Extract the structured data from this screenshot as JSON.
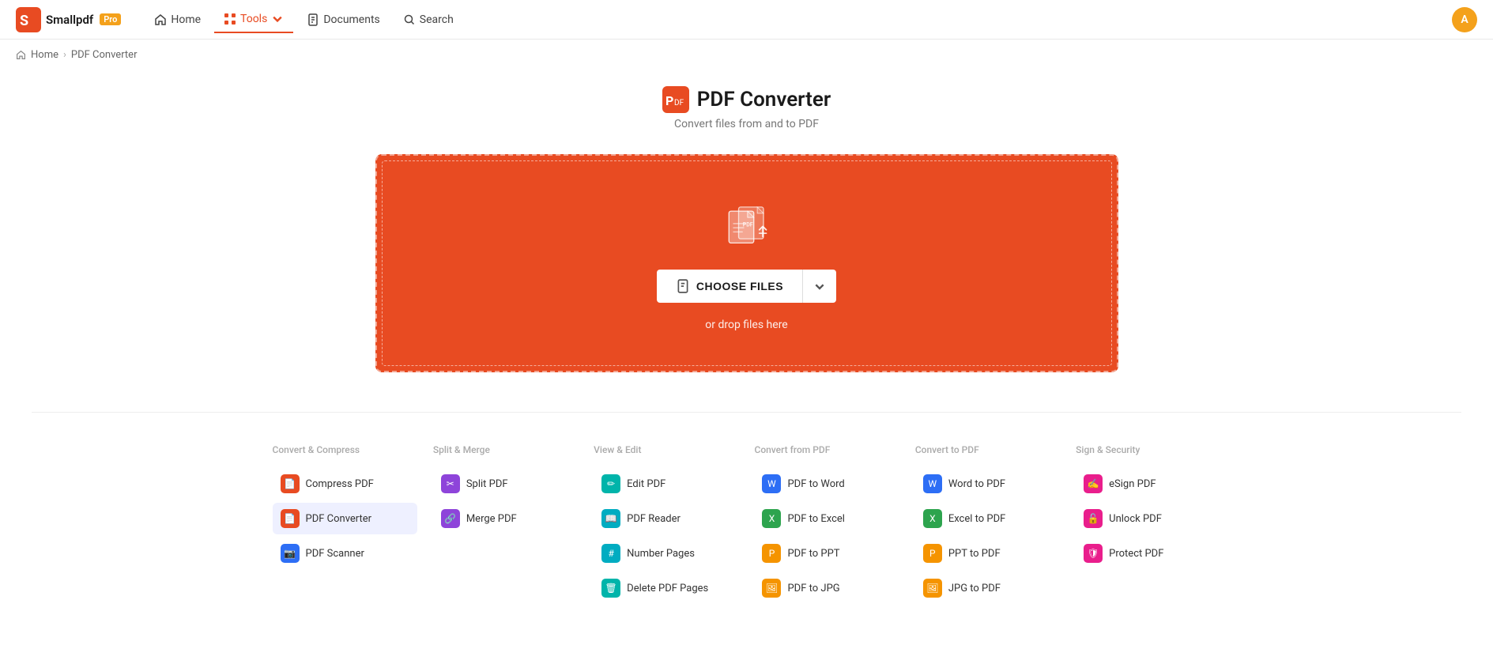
{
  "brand": {
    "name": "Smallpdf",
    "pro_label": "Pro",
    "logo_color": "#e84b22"
  },
  "nav": {
    "home_label": "Home",
    "tools_label": "Tools",
    "documents_label": "Documents",
    "search_label": "Search",
    "avatar_initials": "A"
  },
  "breadcrumb": {
    "home": "Home",
    "current": "PDF Converter"
  },
  "page": {
    "title": "PDF Converter",
    "subtitle": "Convert files from and to PDF"
  },
  "dropzone": {
    "choose_files_label": "CHOOSE FILES",
    "drop_hint": "or drop files here"
  },
  "tools": {
    "columns": [
      {
        "title": "Convert & Compress",
        "items": [
          {
            "label": "Compress PDF",
            "icon_color": "ic-red",
            "icon_char": "📄",
            "active": false
          },
          {
            "label": "PDF Converter",
            "icon_color": "ic-orange-red",
            "icon_char": "📄",
            "active": true
          },
          {
            "label": "PDF Scanner",
            "icon_color": "ic-blue",
            "icon_char": "📷",
            "active": false
          }
        ]
      },
      {
        "title": "Split & Merge",
        "items": [
          {
            "label": "Split PDF",
            "icon_color": "ic-purple",
            "icon_char": "✂",
            "active": false
          },
          {
            "label": "Merge PDF",
            "icon_color": "ic-purple",
            "icon_char": "🔗",
            "active": false
          }
        ]
      },
      {
        "title": "View & Edit",
        "items": [
          {
            "label": "Edit PDF",
            "icon_color": "ic-teal",
            "icon_char": "✏",
            "active": false
          },
          {
            "label": "PDF Reader",
            "icon_color": "ic-cyan",
            "icon_char": "📖",
            "active": false
          },
          {
            "label": "Number Pages",
            "icon_color": "ic-cyan",
            "icon_char": "#",
            "active": false
          },
          {
            "label": "Delete PDF Pages",
            "icon_color": "ic-teal",
            "icon_char": "🗑",
            "active": false
          }
        ]
      },
      {
        "title": "Convert from PDF",
        "items": [
          {
            "label": "PDF to Word",
            "icon_color": "ic-blue",
            "icon_char": "W",
            "active": false
          },
          {
            "label": "PDF to Excel",
            "icon_color": "ic-green",
            "icon_char": "X",
            "active": false
          },
          {
            "label": "PDF to PPT",
            "icon_color": "ic-orange",
            "icon_char": "P",
            "active": false
          },
          {
            "label": "PDF to JPG",
            "icon_color": "ic-orange",
            "icon_char": "🖼",
            "active": false
          }
        ]
      },
      {
        "title": "Convert to PDF",
        "items": [
          {
            "label": "Word to PDF",
            "icon_color": "ic-blue",
            "icon_char": "W",
            "active": false
          },
          {
            "label": "Excel to PDF",
            "icon_color": "ic-green",
            "icon_char": "X",
            "active": false
          },
          {
            "label": "PPT to PDF",
            "icon_color": "ic-orange",
            "icon_char": "P",
            "active": false
          },
          {
            "label": "JPG to PDF",
            "icon_color": "ic-orange",
            "icon_char": "🖼",
            "active": false
          }
        ]
      },
      {
        "title": "Sign & Security",
        "items": [
          {
            "label": "eSign PDF",
            "icon_color": "ic-pink",
            "icon_char": "✍",
            "active": false
          },
          {
            "label": "Unlock PDF",
            "icon_color": "ic-pink",
            "icon_char": "🔓",
            "active": false
          },
          {
            "label": "Protect PDF",
            "icon_color": "ic-pink",
            "icon_char": "🛡",
            "active": false
          }
        ]
      }
    ]
  }
}
